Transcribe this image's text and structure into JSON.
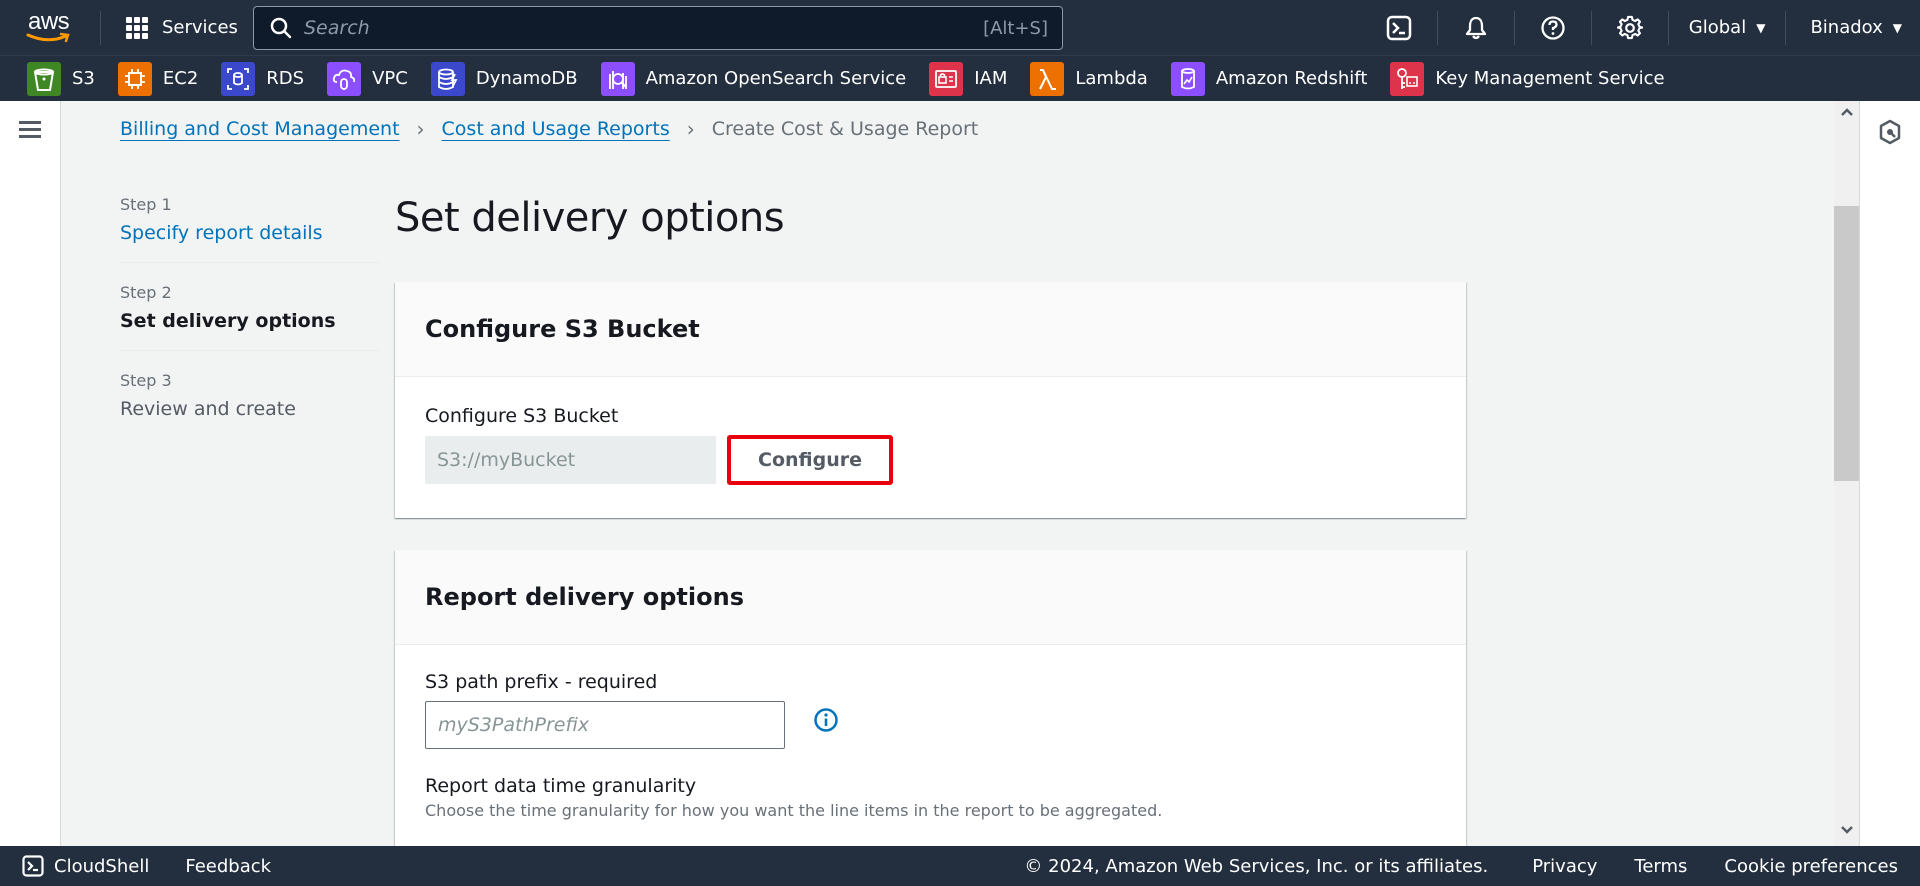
{
  "topnav": {
    "logo_text": "aws",
    "services_label": "Services",
    "search_placeholder": "Search",
    "search_shortcut": "[Alt+S]",
    "icons": [
      "cloudshell-icon",
      "bell-icon",
      "help-icon",
      "settings-icon"
    ],
    "region_label": "Global",
    "account_label": "Binadox"
  },
  "favorites": [
    {
      "label": "S3",
      "icon": "s3-icon",
      "color": "#3f8624"
    },
    {
      "label": "EC2",
      "icon": "ec2-icon",
      "color": "#ed7100"
    },
    {
      "label": "RDS",
      "icon": "rds-icon",
      "color": "#3b48cc"
    },
    {
      "label": "VPC",
      "icon": "vpc-icon",
      "color": "#8c4fff"
    },
    {
      "label": "DynamoDB",
      "icon": "dynamodb-icon",
      "color": "#3b48cc"
    },
    {
      "label": "Amazon OpenSearch Service",
      "icon": "opensearch-icon",
      "color": "#8c4fff"
    },
    {
      "label": "IAM",
      "icon": "iam-icon",
      "color": "#dd344c"
    },
    {
      "label": "Lambda",
      "icon": "lambda-icon",
      "color": "#ed7100"
    },
    {
      "label": "Amazon Redshift",
      "icon": "redshift-icon",
      "color": "#8c4fff"
    },
    {
      "label": "Key Management Service",
      "icon": "kms-icon",
      "color": "#dd344c"
    }
  ],
  "breadcrumb": [
    {
      "label": "Billing and Cost Management",
      "link": true
    },
    {
      "label": "Cost and Usage Reports",
      "link": true
    },
    {
      "label": "Create Cost & Usage Report",
      "link": false
    }
  ],
  "steps": [
    {
      "number": "Step 1",
      "title": "Specify report details",
      "state": "link"
    },
    {
      "number": "Step 2",
      "title": "Set delivery options",
      "state": "active"
    },
    {
      "number": "Step 3",
      "title": "Review and create",
      "state": "disabled"
    }
  ],
  "main": {
    "title": "Set delivery options",
    "s3_panel": {
      "header": "Configure S3 Bucket",
      "field_label": "Configure S3 Bucket",
      "bucket_value": "S3://myBucket",
      "configure_button": "Configure"
    },
    "delivery_panel": {
      "header": "Report delivery options",
      "prefix_label": "S3 path prefix - required",
      "prefix_placeholder": "myS3PathPrefix",
      "granularity_label": "Report data time granularity",
      "granularity_desc": "Choose the time granularity for how you want the line items in the report to be aggregated."
    }
  },
  "footer": {
    "cloudshell": "CloudShell",
    "feedback": "Feedback",
    "copyright": "© 2024, Amazon Web Services, Inc. or its affiliates.",
    "privacy": "Privacy",
    "terms": "Terms",
    "cookies": "Cookie preferences"
  },
  "colors": {
    "nav_bg": "#232f3e",
    "link": "#0073bb",
    "highlight": "#e8000b",
    "page_bg": "#f2f3f3"
  }
}
